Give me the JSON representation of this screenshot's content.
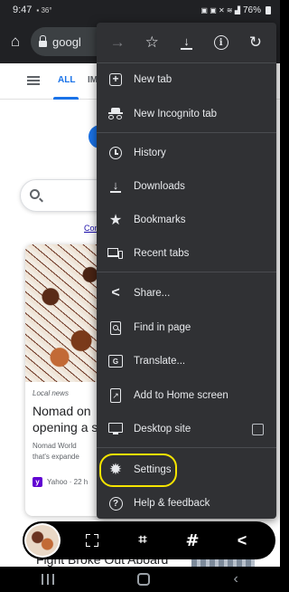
{
  "status_bar": {
    "time": "9:47",
    "left_icons": "▪ 36°",
    "right_icons": "▣ ▣ ✕ ≋ ▟",
    "battery": "76%"
  },
  "toolbar": {
    "url_text": "googl"
  },
  "page": {
    "tab_all": "ALL",
    "tab_images": "IM",
    "consent_link": "Con",
    "card": {
      "tag": "Local news",
      "title": "Nomad on\nopening a s",
      "snippet": "Nomad World\nthat's expande",
      "source": "Yahoo · 22 h"
    },
    "card2_title": "Fight Broke Out Aboard"
  },
  "menu": {
    "items": [
      {
        "label": "New tab",
        "icon": "new-tab-icon"
      },
      {
        "label": "New Incognito tab",
        "icon": "incognito-icon"
      },
      {
        "label": "History",
        "icon": "history-icon"
      },
      {
        "label": "Downloads",
        "icon": "downloads-icon"
      },
      {
        "label": "Bookmarks",
        "icon": "bookmarks-icon"
      },
      {
        "label": "Recent tabs",
        "icon": "recent-tabs-icon"
      },
      {
        "label": "Share...",
        "icon": "share-icon"
      },
      {
        "label": "Find in page",
        "icon": "find-in-page-icon"
      },
      {
        "label": "Translate...",
        "icon": "translate-icon"
      },
      {
        "label": "Add to Home screen",
        "icon": "add-to-home-icon"
      },
      {
        "label": "Desktop site",
        "icon": "desktop-site-icon",
        "checked": false
      },
      {
        "label": "Settings",
        "icon": "settings-icon",
        "highlighted": true
      },
      {
        "label": "Help & feedback",
        "icon": "help-icon"
      }
    ]
  },
  "colors": {
    "menu_bg": "#303134",
    "toolbar_bg": "#202124",
    "highlight": "#f5e400",
    "accent": "#1a73e8"
  }
}
